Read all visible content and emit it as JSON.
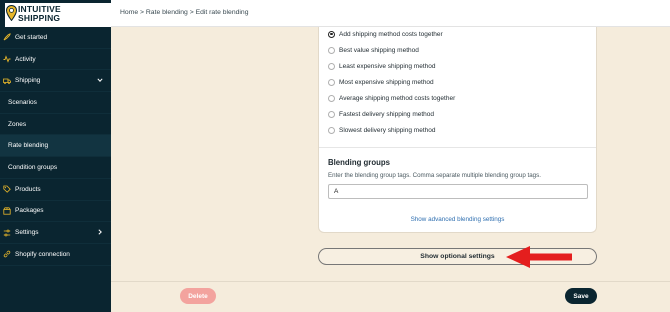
{
  "brand": {
    "line1": "INTUITIVE",
    "line2": "SHIPPING"
  },
  "breadcrumb": "Home > Rate blending > Edit rate blending",
  "sidebar": {
    "items": [
      {
        "label": "Get started",
        "icon": "rocket-icon"
      },
      {
        "label": "Activity",
        "icon": "activity-icon"
      },
      {
        "label": "Shipping",
        "icon": "truck-icon",
        "expanded": true
      },
      {
        "label": "Scenarios"
      },
      {
        "label": "Zones"
      },
      {
        "label": "Rate blending",
        "active": true
      },
      {
        "label": "Condition groups"
      },
      {
        "label": "Products",
        "icon": "tag-icon"
      },
      {
        "label": "Packages",
        "icon": "box-icon"
      },
      {
        "label": "Settings",
        "icon": "gear-icon"
      },
      {
        "label": "Shopify connection",
        "icon": "link-icon"
      }
    ]
  },
  "blending": {
    "options": [
      {
        "label": "Add shipping method costs together",
        "checked": true
      },
      {
        "label": "Best value shipping method"
      },
      {
        "label": "Least expensive shipping method"
      },
      {
        "label": "Most expensive shipping method"
      },
      {
        "label": "Average shipping method costs together"
      },
      {
        "label": "Fastest delivery shipping method"
      },
      {
        "label": "Slowest delivery shipping method"
      }
    ],
    "groups_title": "Blending groups",
    "groups_help": "Enter the blending group tags. Comma separate multiple blending group tags.",
    "groups_value": "A",
    "advanced_link": "Show advanced blending settings"
  },
  "optional_settings_label": "Show optional settings",
  "actions": {
    "delete_label": "Delete",
    "save_label": "Save"
  },
  "colors": {
    "sidebar": "#0a2530",
    "accent": "#e8b72a",
    "arrow": "#e41e1e",
    "delete": "#f3a39e",
    "background": "#f5ecdc"
  }
}
